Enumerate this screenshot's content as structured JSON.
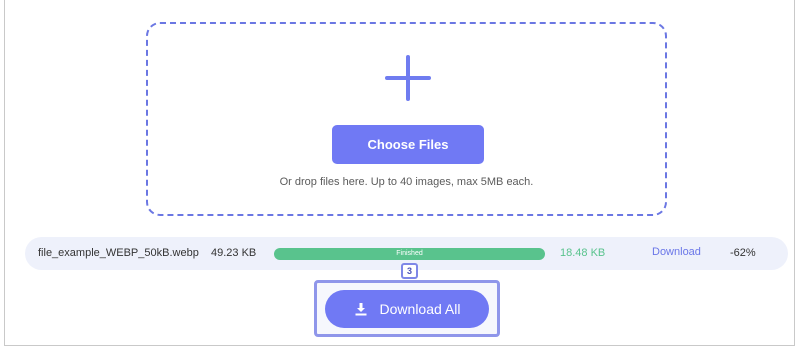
{
  "upload": {
    "plus_icon": "plus-icon",
    "choose_label": "Choose Files",
    "hint": "Or drop files here. Up to 40 images, max 5MB each."
  },
  "files": [
    {
      "name": "file_example_WEBP_50kB.webp",
      "original_size": "49.23 KB",
      "status": "Finished",
      "progress": 1.0,
      "new_size": "18.48 KB",
      "action": "Download",
      "reduction": "-62%"
    }
  ],
  "step_badge": "3",
  "download_all": {
    "icon": "download-icon",
    "label": "Download All"
  },
  "colors": {
    "accent": "#7079f4",
    "success": "#59c38d",
    "row_bg": "#eef1fb",
    "dashed_border": "#6b77e3"
  }
}
